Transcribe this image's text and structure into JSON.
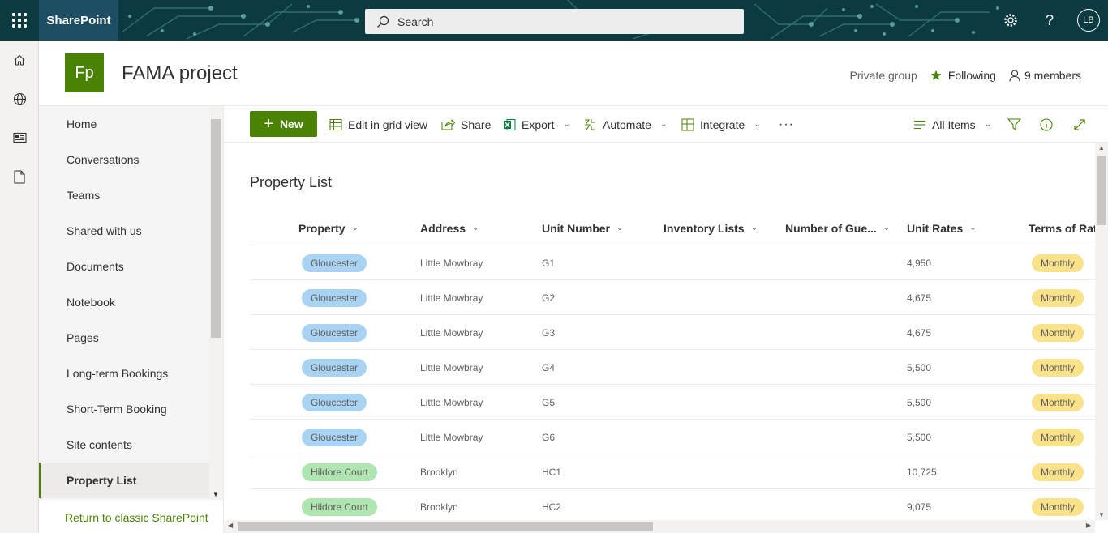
{
  "suite": {
    "brand": "SharePoint",
    "search_placeholder": "Search",
    "avatar_initials": "LB",
    "colors": {
      "bar": "#0b3a40",
      "brand_tile": "#1e4e64"
    }
  },
  "site": {
    "logo_initials": "Fp",
    "title": "FAMA project",
    "privacy": "Private group",
    "follow_label": "Following",
    "members_label": "9 members",
    "accent": "#498205"
  },
  "nav": {
    "items": [
      {
        "label": "Home"
      },
      {
        "label": "Conversations"
      },
      {
        "label": "Teams"
      },
      {
        "label": "Shared with us"
      },
      {
        "label": "Documents"
      },
      {
        "label": "Notebook"
      },
      {
        "label": "Pages"
      },
      {
        "label": "Long-term Bookings"
      },
      {
        "label": "Short-Term Booking"
      },
      {
        "label": "Site contents"
      },
      {
        "label": "Property List",
        "active": true
      }
    ],
    "classic_link": "Return to classic SharePoint"
  },
  "commands": {
    "new": "New",
    "edit_grid": "Edit in grid view",
    "share": "Share",
    "export": "Export",
    "automate": "Automate",
    "integrate": "Integrate",
    "more": "···",
    "view": "All Items"
  },
  "list": {
    "title": "Property List",
    "columns": [
      "Property",
      "Address",
      "Unit Number",
      "Inventory Lists",
      "Number of Gue...",
      "Unit Rates",
      "Terms of Rate"
    ],
    "rows": [
      {
        "property": "Gloucester",
        "color": "blue",
        "address": "Little Mowbray",
        "unit": "G1",
        "rate": "4,950",
        "terms": "Monthly"
      },
      {
        "property": "Gloucester",
        "color": "blue",
        "address": "Little Mowbray",
        "unit": "G2",
        "rate": "4,675",
        "terms": "Monthly"
      },
      {
        "property": "Gloucester",
        "color": "blue",
        "address": "Little Mowbray",
        "unit": "G3",
        "rate": "4,675",
        "terms": "Monthly"
      },
      {
        "property": "Gloucester",
        "color": "blue",
        "address": "Little Mowbray",
        "unit": "G4",
        "rate": "5,500",
        "terms": "Monthly"
      },
      {
        "property": "Gloucester",
        "color": "blue",
        "address": "Little Mowbray",
        "unit": "G5",
        "rate": "5,500",
        "terms": "Monthly"
      },
      {
        "property": "Gloucester",
        "color": "blue",
        "address": "Little Mowbray",
        "unit": "G6",
        "rate": "5,500",
        "terms": "Monthly"
      },
      {
        "property": "Hildore Court",
        "color": "green",
        "address": "Brooklyn",
        "unit": "HC1",
        "rate": "10,725",
        "terms": "Monthly"
      },
      {
        "property": "Hildore Court",
        "color": "green",
        "address": "Brooklyn",
        "unit": "HC2",
        "rate": "9,075",
        "terms": "Monthly"
      }
    ]
  }
}
